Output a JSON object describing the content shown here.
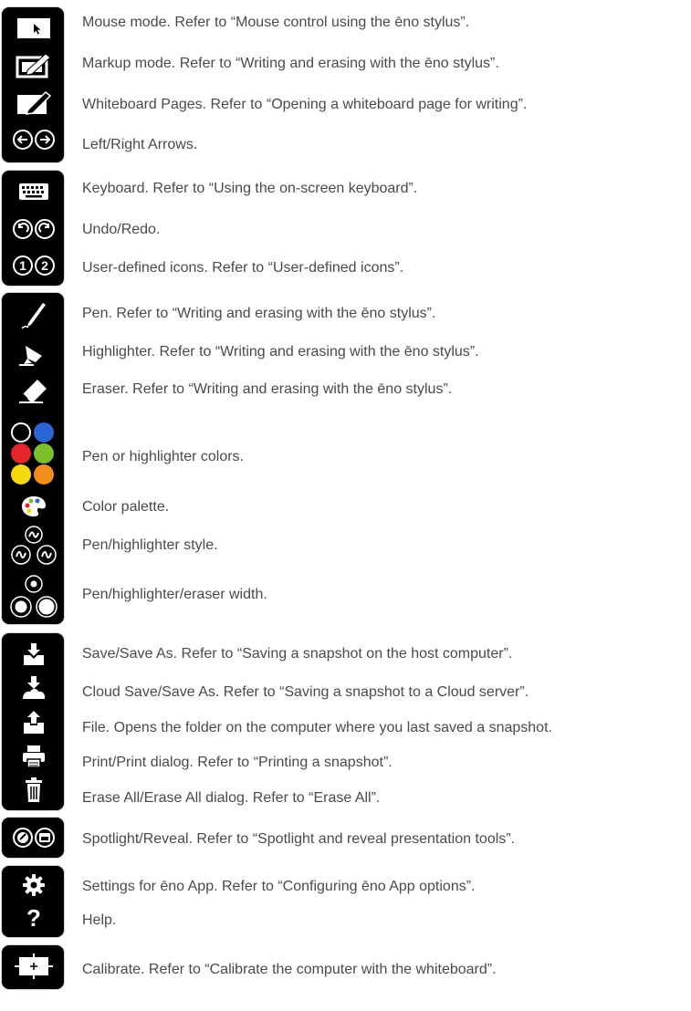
{
  "toolbar": {
    "colors": {
      "frame": "#000000",
      "border": "#d8d8d8",
      "white": "#ffffff",
      "blue": "#2d64d6",
      "red": "#e4232a",
      "green": "#7bbf2a",
      "yellow": "#f5d90d",
      "orange": "#f28c1c"
    },
    "help_glyph": "?",
    "user_icon_1": "1",
    "user_icon_2": "2"
  },
  "items": [
    {
      "icon": "mouse-mode-icon",
      "text": "Mouse mode. Refer to “Mouse control using the ēno stylus”."
    },
    {
      "icon": "markup-mode-icon",
      "text": "Markup mode. Refer to “Writing and erasing with the ēno stylus”."
    },
    {
      "icon": "whiteboard-pages-icon",
      "text": "Whiteboard Pages. Refer to “Opening a whiteboard page for writing”."
    },
    {
      "icon": "left-right-arrows-icon",
      "text": "Left/Right Arrows."
    },
    {
      "icon": "keyboard-icon",
      "text": "Keyboard. Refer to “Using the on-screen keyboard”."
    },
    {
      "icon": "undo-redo-icon",
      "text": "Undo/Redo."
    },
    {
      "icon": "user-defined-icons-icon",
      "text": "User-defined icons. Refer to “User-defined icons”."
    },
    {
      "icon": "pen-icon",
      "text": "Pen. Refer to “Writing and erasing with the ēno stylus”."
    },
    {
      "icon": "highlighter-icon",
      "text": "Highlighter. Refer to “Writing and erasing with the ēno stylus”."
    },
    {
      "icon": "eraser-icon",
      "text": "Eraser. Refer to “Writing and erasing with the ēno stylus”."
    },
    {
      "icon": "pen-colors-icon",
      "text": "Pen or highlighter colors."
    },
    {
      "icon": "color-palette-icon",
      "text": "Color palette."
    },
    {
      "icon": "pen-style-icon",
      "text": "Pen/highlighter style."
    },
    {
      "icon": "width-icon",
      "text": "Pen/highlighter/eraser width."
    },
    {
      "icon": "save-icon",
      "text": "Save/Save As. Refer to “Saving a snapshot on the host computer”."
    },
    {
      "icon": "cloud-save-icon",
      "text": "Cloud Save/Save As. Refer to “Saving a snapshot to a Cloud server”."
    },
    {
      "icon": "file-icon",
      "text": "File. Opens the folder on the computer where you last saved a snapshot."
    },
    {
      "icon": "print-icon",
      "text": "Print/Print dialog. Refer to “Printing a snapshot”."
    },
    {
      "icon": "erase-all-icon",
      "text": "Erase All/Erase All dialog. Refer to “Erase All”."
    },
    {
      "icon": "spotlight-reveal-icon",
      "text": "Spotlight/Reveal. Refer to “Spotlight and reveal presentation tools”."
    },
    {
      "icon": "settings-icon",
      "text": "Settings for ēno App. Refer to “Configuring ēno App options”."
    },
    {
      "icon": "help-icon",
      "text": "Help."
    },
    {
      "icon": "calibrate-icon",
      "text": "Calibrate. Refer to “Calibrate the computer with the whiteboard”."
    }
  ]
}
